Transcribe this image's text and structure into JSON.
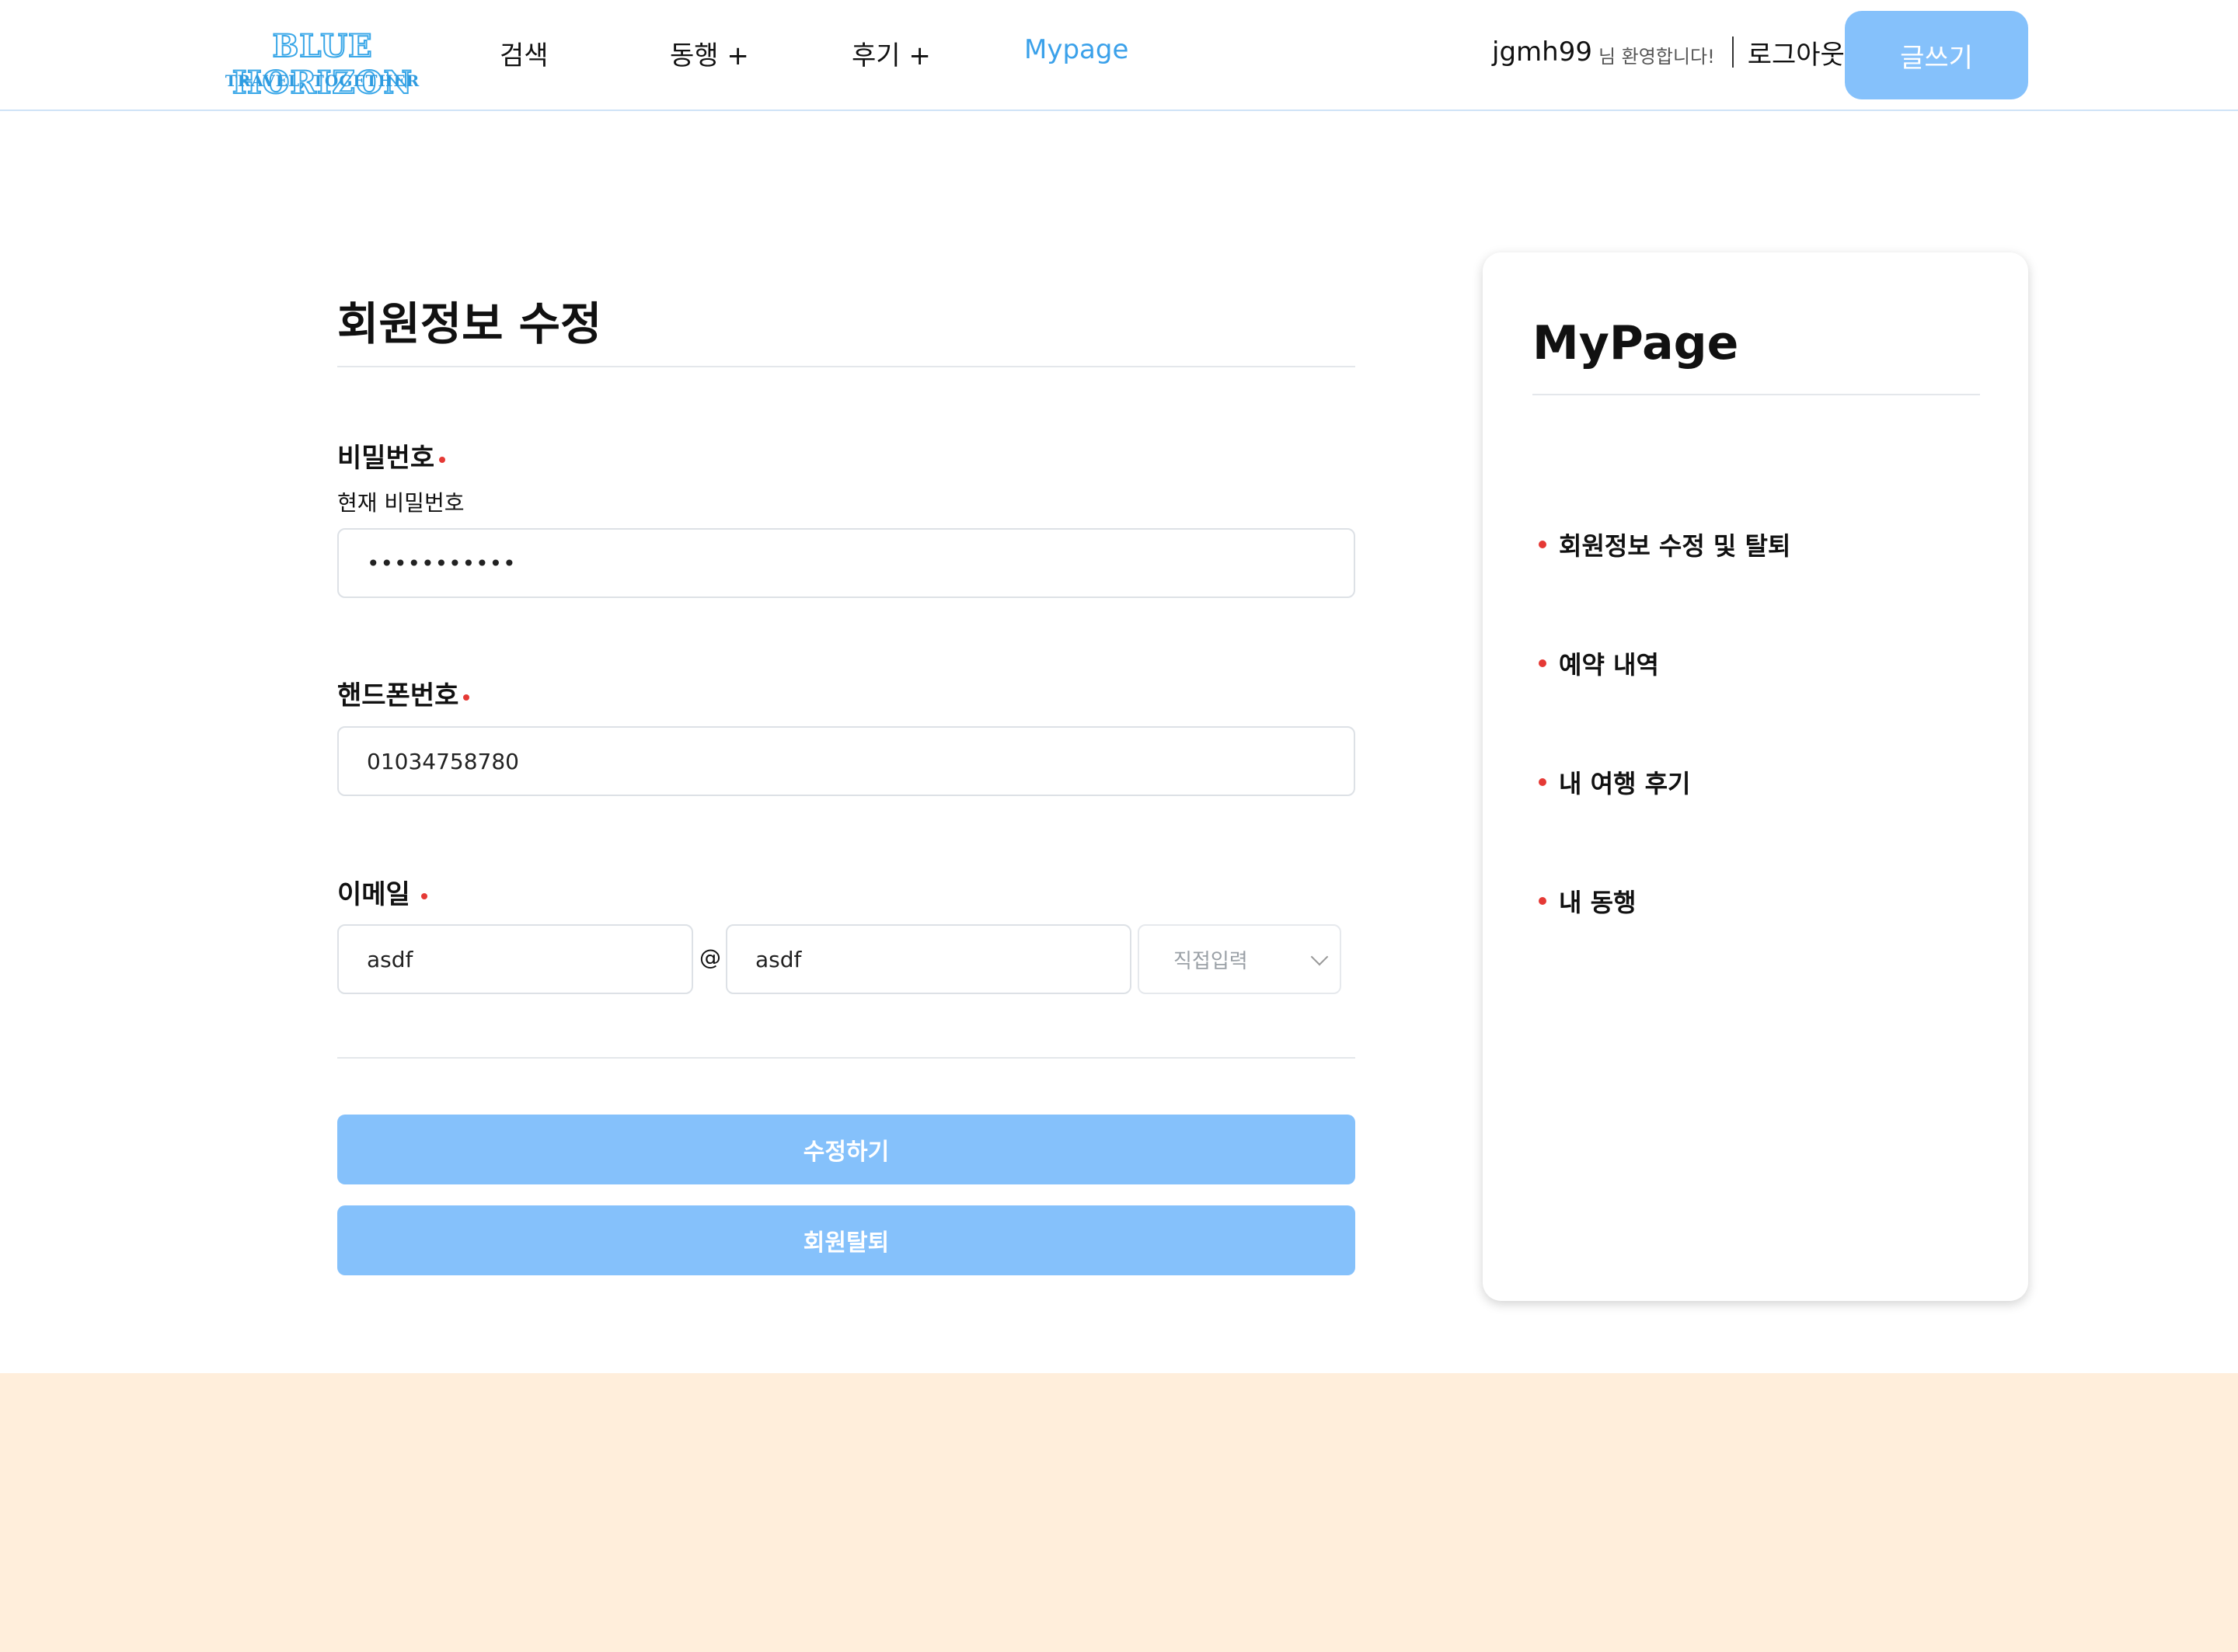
{
  "header": {
    "logo_main": "BLUE HORIZON",
    "logo_sub": "TRAVEL, TOGETHER",
    "nav": [
      {
        "label": "검색"
      },
      {
        "label": "동행 +"
      },
      {
        "label": "후기 +"
      },
      {
        "label": "Mypage"
      }
    ],
    "user_name": "jgmh99",
    "user_greeting": "님 환영합니다!",
    "logout_label": "로그아웃",
    "write_label": "글쓰기",
    "accent_color": "#85c1fb",
    "active_nav_color": "#3ba1ea"
  },
  "form": {
    "title": "회원정보 수정",
    "password": {
      "label": "비밀번호",
      "sub_label": "현재 비밀번호",
      "value": "•••••••••••"
    },
    "phone": {
      "label": "핸드폰번호",
      "value": "01034758780"
    },
    "email": {
      "label": "이메일",
      "local_value": "asdf",
      "at": "@",
      "domain_value": "asdf",
      "domain_select": "직접입력"
    },
    "submit_label": "수정하기",
    "withdraw_label": "회원탈퇴",
    "required_color": "#e53935"
  },
  "sidebar": {
    "title": "MyPage",
    "items": [
      {
        "label": "회원정보 수정 및 탈퇴"
      },
      {
        "label": "예약 내역"
      },
      {
        "label": "내 여행 후기"
      },
      {
        "label": "내 동행"
      }
    ]
  },
  "footer": {
    "background": "#ffeedb"
  }
}
